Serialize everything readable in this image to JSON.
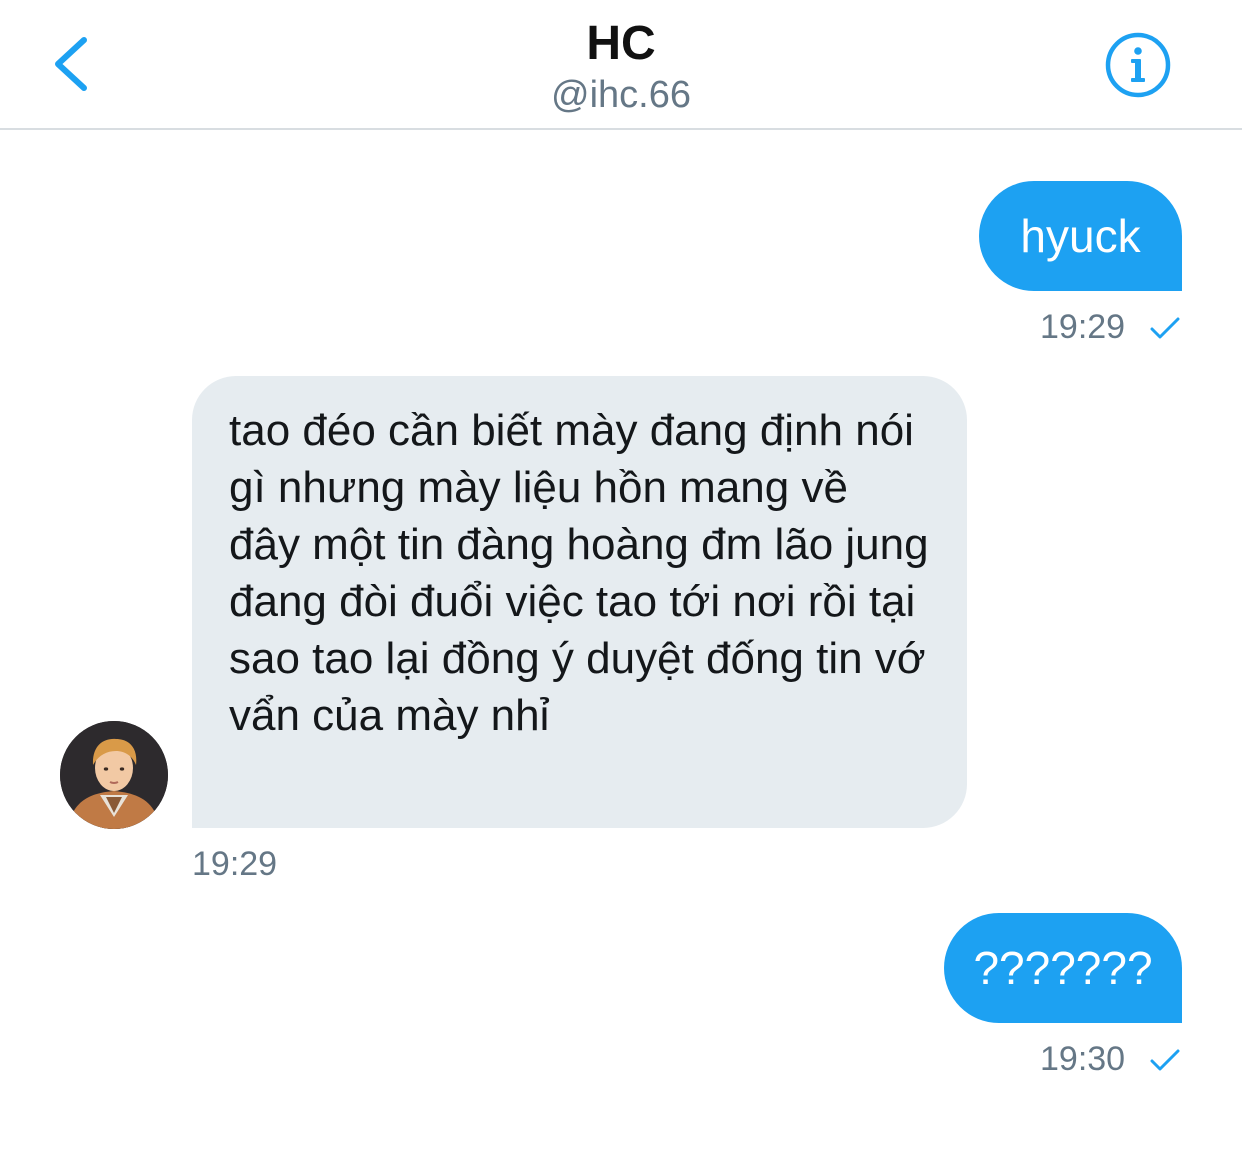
{
  "header": {
    "title": "HC",
    "handle": "@ihc.66",
    "back_icon": "chevron-left-icon",
    "info_icon": "info-circle-icon"
  },
  "accent_color": "#1da1f2",
  "messages": [
    {
      "direction": "outgoing",
      "text": "hyuck",
      "time": "19:29",
      "status_icon": "checkmark-icon"
    },
    {
      "direction": "incoming",
      "text": "tao đéo cần biết mày đang định nói gì nhưng mày liệu hồn mang về đây một tin đàng hoàng đm lão jung đang đòi đuổi việc tao tới nơi rồi tại sao tao lại đồng ý duyệt đống tin vớ vẩn của mày nhỉ",
      "time": "19:29",
      "avatar_icon": "user-avatar"
    },
    {
      "direction": "outgoing",
      "text": "???????",
      "time": "19:30",
      "status_icon": "checkmark-icon"
    }
  ]
}
